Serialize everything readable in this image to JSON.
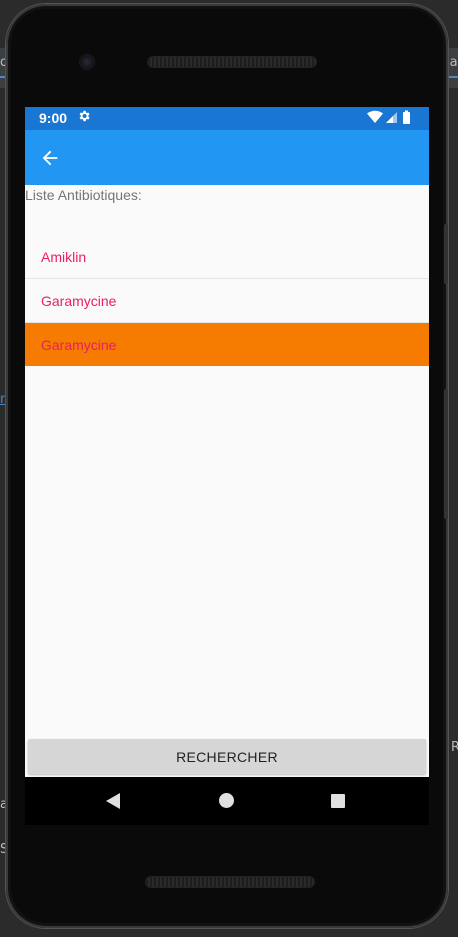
{
  "ide": {
    "left_fragments": [
      "d",
      "n",
      "a",
      "S"
    ],
    "right_fragments": [
      "la",
      "R"
    ]
  },
  "status_bar": {
    "time": "9:00",
    "settings_icon": "gear-icon",
    "wifi_icon": "wifi-icon",
    "signal_icon": "cell-signal-icon",
    "battery_icon": "battery-icon"
  },
  "app_bar": {
    "back_icon": "arrow-left-icon",
    "color": "#2196f3"
  },
  "content": {
    "list_label": "Liste Antibiotiques:",
    "items": [
      {
        "label": "Amiklin",
        "selected": false
      },
      {
        "label": "Garamycine",
        "selected": false
      },
      {
        "label": "Garamycine",
        "selected": true
      }
    ],
    "search_button": "RECHERCHER"
  },
  "colors": {
    "status_bar": "#1976d2",
    "app_bar": "#2196f3",
    "item_text": "#e91e63",
    "selected_item": "#f57c00"
  },
  "nav_bar": {
    "back_icon": "nav-back-icon",
    "home_icon": "nav-home-icon",
    "recents_icon": "nav-recents-icon"
  }
}
